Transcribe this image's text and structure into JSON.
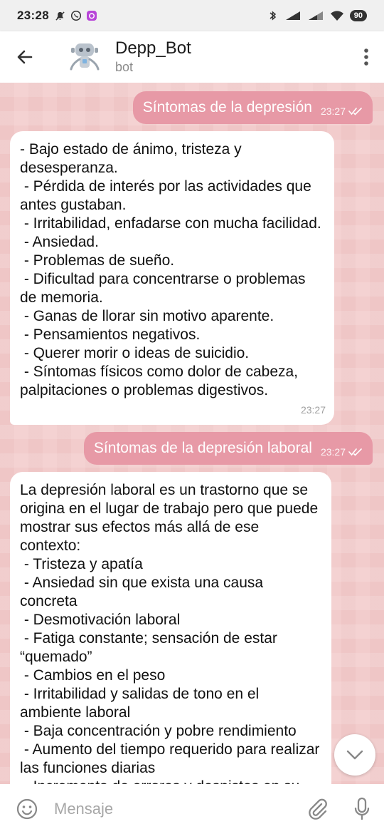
{
  "status_bar": {
    "time": "23:28",
    "battery": "90"
  },
  "header": {
    "title": "Depp_Bot",
    "subtitle": "bot"
  },
  "messages": [
    {
      "direction": "out",
      "text": "Síntomas de la depresión",
      "time": "23:27"
    },
    {
      "direction": "in",
      "text": "- Bajo estado de ánimo, tristeza y desesperanza.\n - Pérdida de interés por las actividades que antes gustaban.\n - Irritabilidad, enfadarse con mucha facilidad.\n - Ansiedad.\n - Problemas de sueño.\n - Dificultad para concentrarse o problemas de memoria.\n - Ganas de llorar sin motivo aparente.\n - Pensamientos negativos.\n - Querer morir o ideas de suicidio.\n - Síntomas físicos como dolor de cabeza, palpitaciones o problemas digestivos.",
      "time": "23:27"
    },
    {
      "direction": "out",
      "text": "Síntomas de la depresión laboral",
      "time": "23:27"
    },
    {
      "direction": "in",
      "text": "La depresión laboral es un trastorno que se origina en el lugar de trabajo pero que puede mostrar sus efectos más allá de ese contexto:\n - Tristeza y apatía\n - Ansiedad sin que exista una causa concreta\n - Desmotivación laboral\n - Fatiga constante; sensación de estar “quemado”\n - Cambios en el peso\n - Irritabilidad y salidas de tono en el ambiente laboral\n - Baja concentración y pobre rendimiento\n - Aumento del tiempo requerido para realizar las funciones diarias\n - Incremento de errores y despistes en su"
    }
  ],
  "input": {
    "placeholder": "Mensaje"
  },
  "colors": {
    "outgoing_bubble": "#e799a6",
    "chat_background": "#f2cccc",
    "incoming_bubble": "#ffffff"
  }
}
